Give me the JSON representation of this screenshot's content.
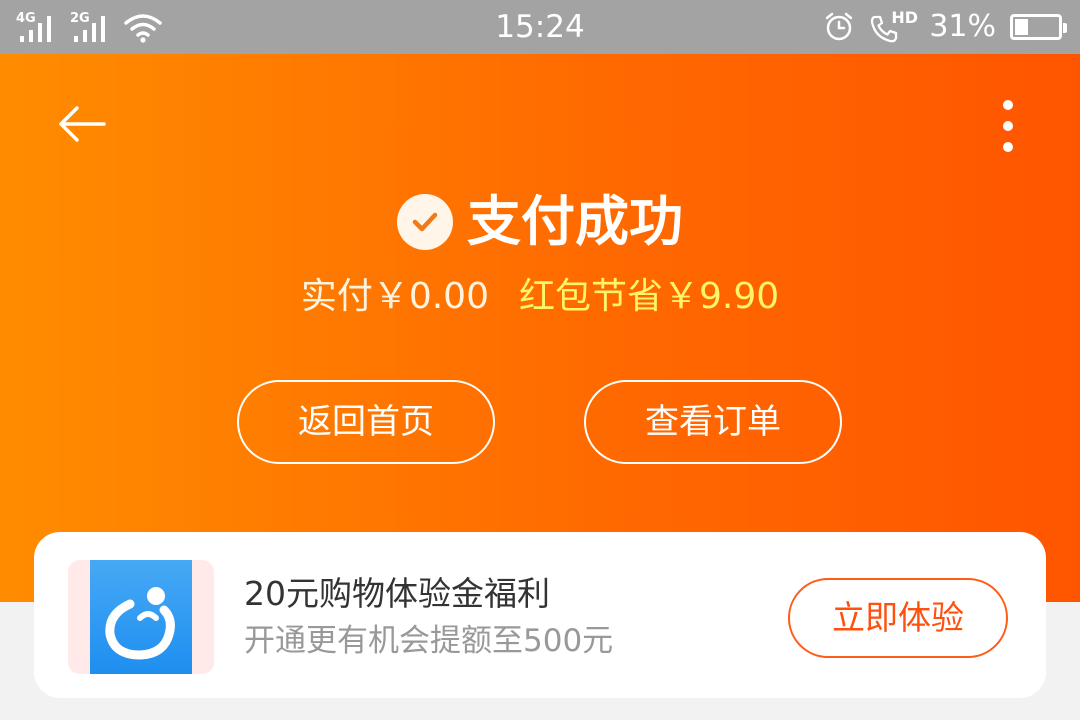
{
  "status_bar": {
    "network_1": "4G",
    "network_2": "2G",
    "time": "15:24",
    "call_label": "HD",
    "battery_percent": "31%",
    "battery_level": 0.31,
    "icons": [
      "signal-4g-icon",
      "signal-2g-icon",
      "wifi-icon",
      "alarm-icon",
      "hd-call-icon",
      "battery-icon"
    ]
  },
  "header": {
    "back_icon": "back-arrow-icon",
    "more_icon": "more-vertical-icon",
    "status_icon": "check-circle-icon",
    "title": "支付成功",
    "paid_text": "实付￥0.00",
    "saved_text": "红包节省￥9.90",
    "home_button": "返回首页",
    "order_button": "查看订单"
  },
  "promo": {
    "title": "20元购物体验金福利",
    "subtitle": "开通更有机会提额至500元",
    "button": "立即体验",
    "image_icon": "app-phone-icon"
  },
  "colors": {
    "accent": "#ff6a00",
    "gradient_start": "#ff8c00",
    "gradient_end": "#ff5500",
    "highlight_yellow": "#fff56a",
    "button_orange": "#ff5010"
  }
}
